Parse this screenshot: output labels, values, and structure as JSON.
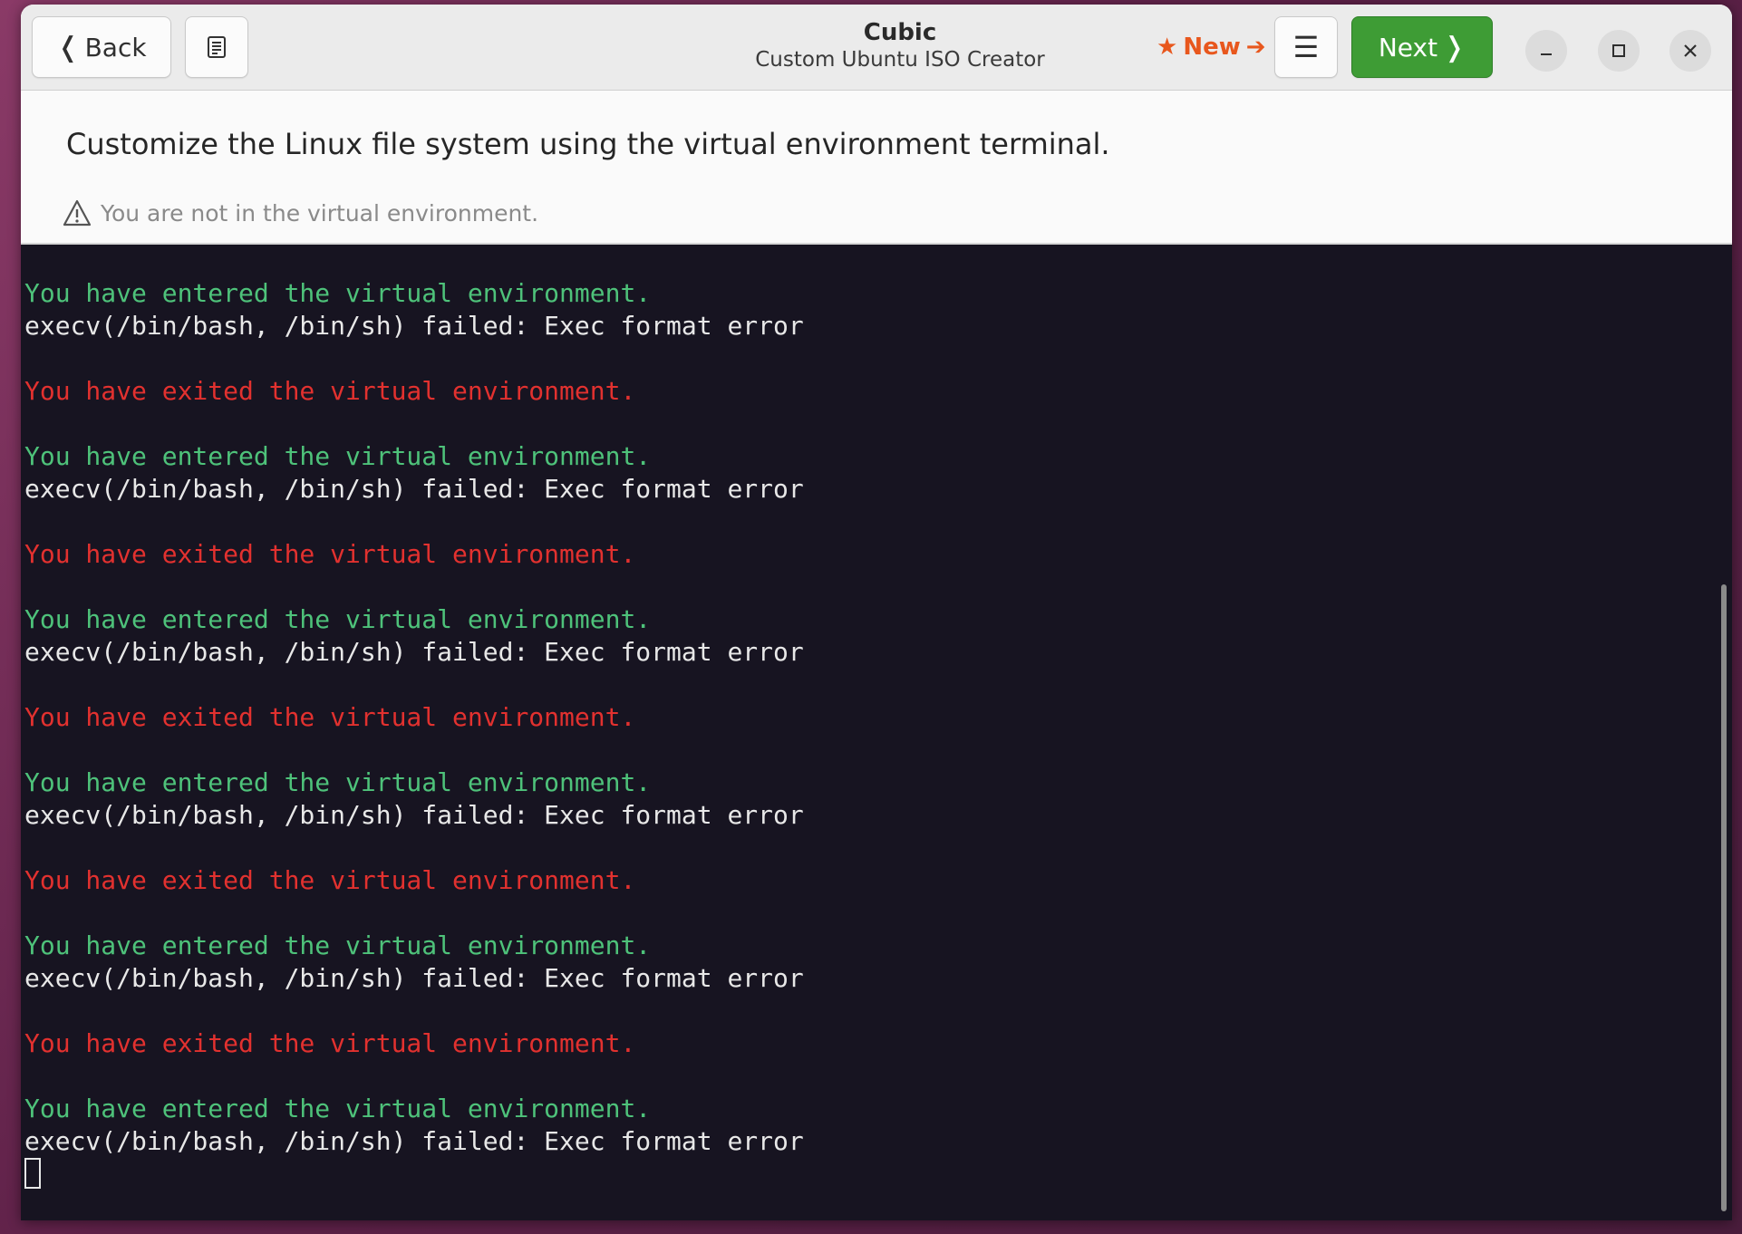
{
  "header": {
    "back_label": "Back",
    "app_title": "Cubic",
    "app_subtitle": "Custom Ubuntu ISO Creator",
    "new_label": "New",
    "next_label": "Next"
  },
  "icons": {
    "back": "chevron-left-icon",
    "document": "document-icon",
    "new_star": "star-icon",
    "new_arrow": "arrow-right-icon",
    "menu": "hamburger-menu-icon",
    "next": "chevron-right-icon",
    "minimize": "minimize-icon",
    "maximize": "maximize-icon",
    "close": "close-icon",
    "warning": "warning-icon"
  },
  "colors": {
    "next_button": "#3e9c35",
    "new_link": "#e8571d",
    "terminal_bg": "#171421",
    "terminal_green": "#4ec27a",
    "terminal_red": "#e2312f",
    "terminal_text": "#e8e8e8"
  },
  "info": {
    "instruction": "Customize the Linux file system using the virtual environment terminal.",
    "status": "You are not in the virtual environment."
  },
  "terminal": {
    "lines": [
      {
        "text": "You have entered the virtual environment.",
        "color": "green"
      },
      {
        "text": "execv(/bin/bash, /bin/sh) failed: Exec format error",
        "color": "white"
      },
      {
        "text": "",
        "color": "blank"
      },
      {
        "text": "You have exited the virtual environment.",
        "color": "red"
      },
      {
        "text": "",
        "color": "blank"
      },
      {
        "text": "You have entered the virtual environment.",
        "color": "green"
      },
      {
        "text": "execv(/bin/bash, /bin/sh) failed: Exec format error",
        "color": "white"
      },
      {
        "text": "",
        "color": "blank"
      },
      {
        "text": "You have exited the virtual environment.",
        "color": "red"
      },
      {
        "text": "",
        "color": "blank"
      },
      {
        "text": "You have entered the virtual environment.",
        "color": "green"
      },
      {
        "text": "execv(/bin/bash, /bin/sh) failed: Exec format error",
        "color": "white"
      },
      {
        "text": "",
        "color": "blank"
      },
      {
        "text": "You have exited the virtual environment.",
        "color": "red"
      },
      {
        "text": "",
        "color": "blank"
      },
      {
        "text": "You have entered the virtual environment.",
        "color": "green"
      },
      {
        "text": "execv(/bin/bash, /bin/sh) failed: Exec format error",
        "color": "white"
      },
      {
        "text": "",
        "color": "blank"
      },
      {
        "text": "You have exited the virtual environment.",
        "color": "red"
      },
      {
        "text": "",
        "color": "blank"
      },
      {
        "text": "You have entered the virtual environment.",
        "color": "green"
      },
      {
        "text": "execv(/bin/bash, /bin/sh) failed: Exec format error",
        "color": "white"
      },
      {
        "text": "",
        "color": "blank"
      },
      {
        "text": "You have exited the virtual environment.",
        "color": "red"
      },
      {
        "text": "",
        "color": "blank"
      },
      {
        "text": "You have entered the virtual environment.",
        "color": "green"
      },
      {
        "text": "execv(/bin/bash, /bin/sh) failed: Exec format error",
        "color": "white"
      }
    ]
  }
}
